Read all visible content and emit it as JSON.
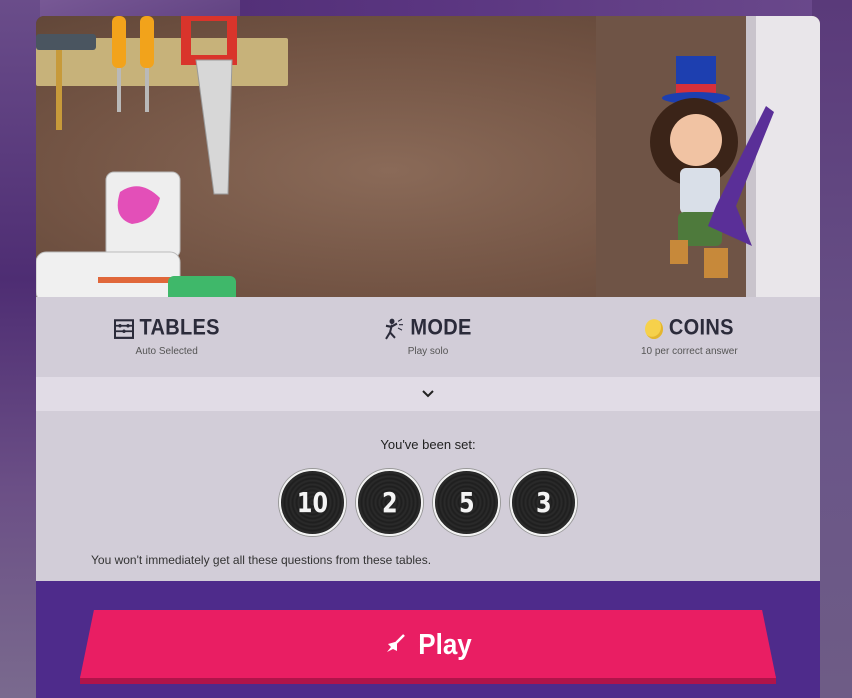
{
  "info": {
    "tables": {
      "title": "TABLES",
      "sub": "Auto Selected",
      "icon": "abacus-icon"
    },
    "mode": {
      "title": "MODE",
      "sub": "Play solo",
      "icon": "rockstar-icon"
    },
    "coins": {
      "title": "COINS",
      "sub": "10 per correct answer",
      "icon": "coin-icon"
    }
  },
  "set": {
    "label": "You've been set:",
    "tables": [
      "10",
      "2",
      "5",
      "3"
    ],
    "note": "You won't immediately get all these questions from these tables."
  },
  "play": {
    "label": "Play",
    "icon": "guitar-icon"
  },
  "colors": {
    "accent": "#e91e63",
    "panel": "#d2cdd8",
    "card": "#4e2b8b"
  }
}
